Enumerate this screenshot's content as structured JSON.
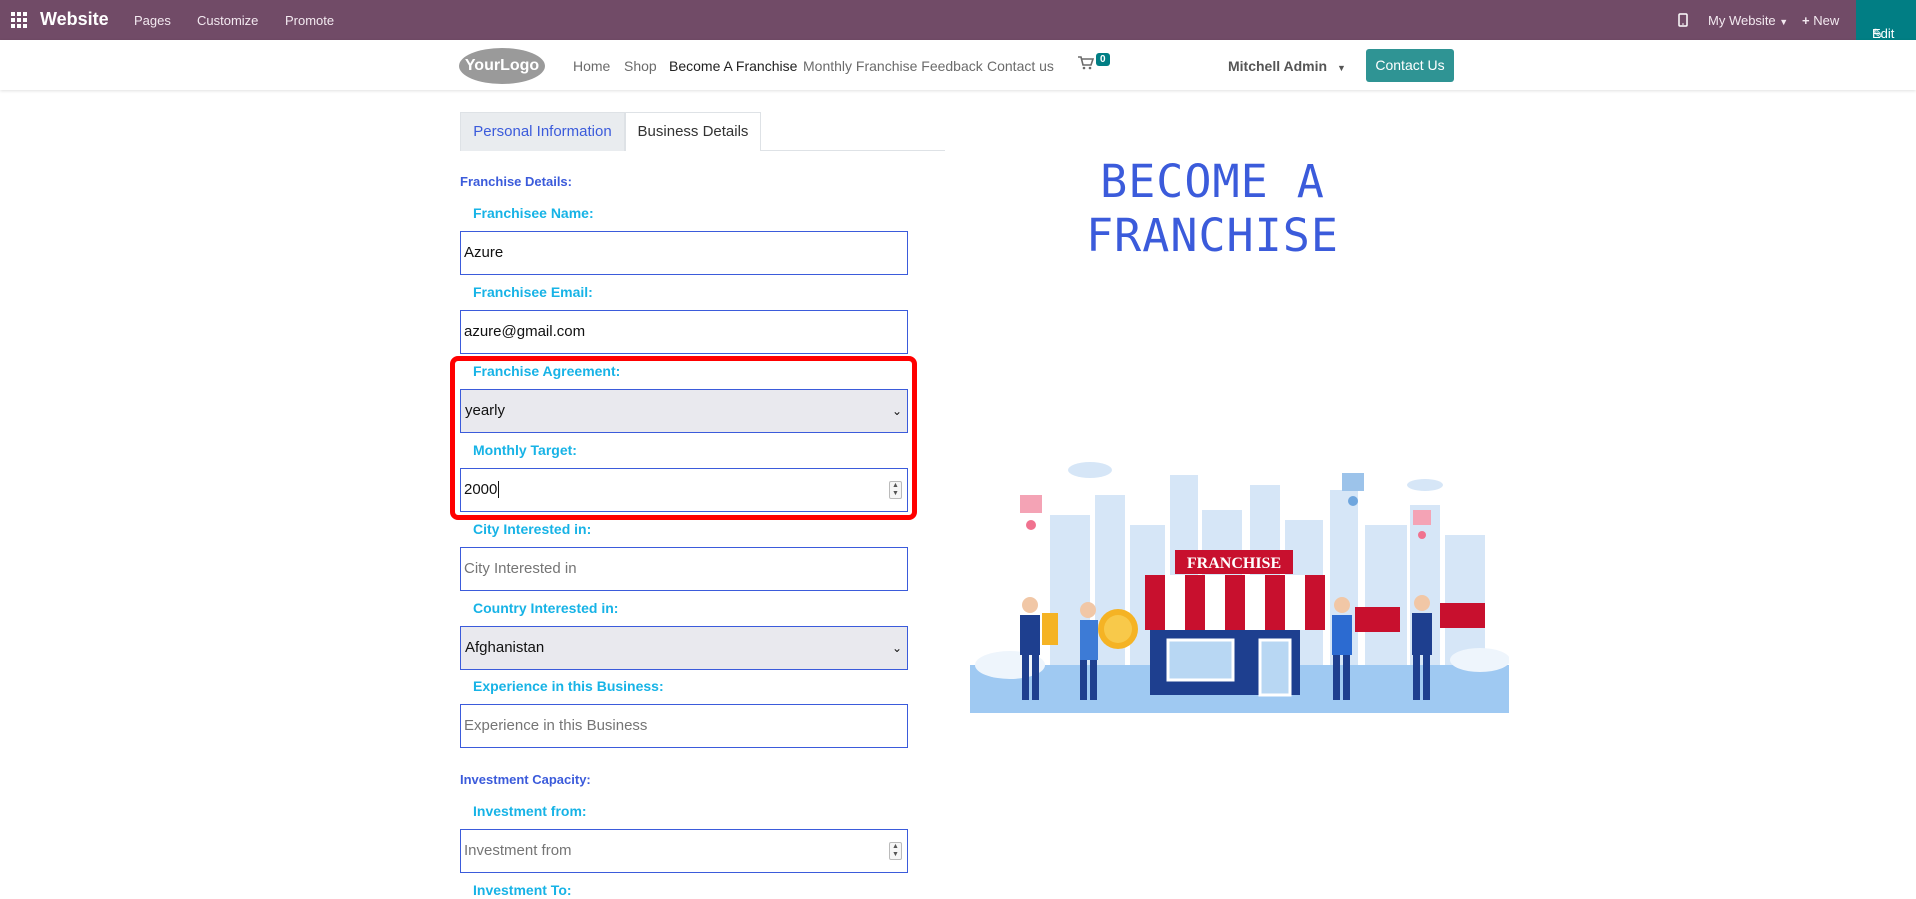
{
  "topbar": {
    "brand": "Website",
    "menu": [
      "Pages",
      "Customize",
      "Promote"
    ],
    "site": "My Website",
    "new_label": "New",
    "edit_label": "Edit"
  },
  "nav": {
    "logo": "YourLogo",
    "links": [
      "Home",
      "Shop",
      "Become A Franchise",
      "Monthly Franchise Feedback",
      "Contact us"
    ],
    "cart_count": "0",
    "user": "Mitchell Admin",
    "contact_button": "Contact Us"
  },
  "tabs": [
    "Personal Information",
    "Business Details"
  ],
  "form": {
    "franchise_details_title": "Franchise Details:",
    "franchisee_name": {
      "label": "Franchisee Name:",
      "value": "Azure"
    },
    "franchisee_email": {
      "label": "Franchisee Email:",
      "value": "azure@gmail.com"
    },
    "franchise_agreement": {
      "label": "Franchise Agreement:",
      "value": "yearly"
    },
    "monthly_target": {
      "label": "Monthly Target:",
      "value": "2000"
    },
    "city_interested": {
      "label": "City Interested in:",
      "placeholder": "City Interested in"
    },
    "country_interested": {
      "label": "Country Interested in:",
      "value": "Afghanistan"
    },
    "experience": {
      "label": "Experience in this Business:",
      "placeholder": "Experience in this Business"
    },
    "investment_capacity_title": "Investment Capacity:",
    "investment_from": {
      "label": "Investment from:",
      "placeholder": "Investment from"
    },
    "investment_to": {
      "label": "Investment To:"
    }
  },
  "hero": {
    "title_line1": "BECOME A",
    "title_line2": "FRANCHISE",
    "sign_text": "FRANCHISE"
  }
}
